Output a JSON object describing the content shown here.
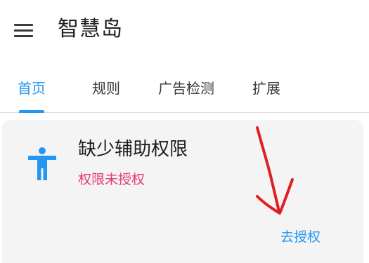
{
  "app": {
    "title": "智慧岛"
  },
  "tabs": [
    {
      "label": "首页",
      "active": true
    },
    {
      "label": "规则",
      "active": false
    },
    {
      "label": "广告检测",
      "active": false
    },
    {
      "label": "扩展",
      "active": false
    }
  ],
  "permission_card": {
    "title": "缺少辅助权限",
    "status": "权限未授权",
    "action_label": "去授权",
    "icon": "accessibility-icon"
  },
  "colors": {
    "accent": "#2196f3",
    "status_warning": "#e8377a",
    "annotation": "#e02020",
    "card_background": "#f4f4f4"
  }
}
